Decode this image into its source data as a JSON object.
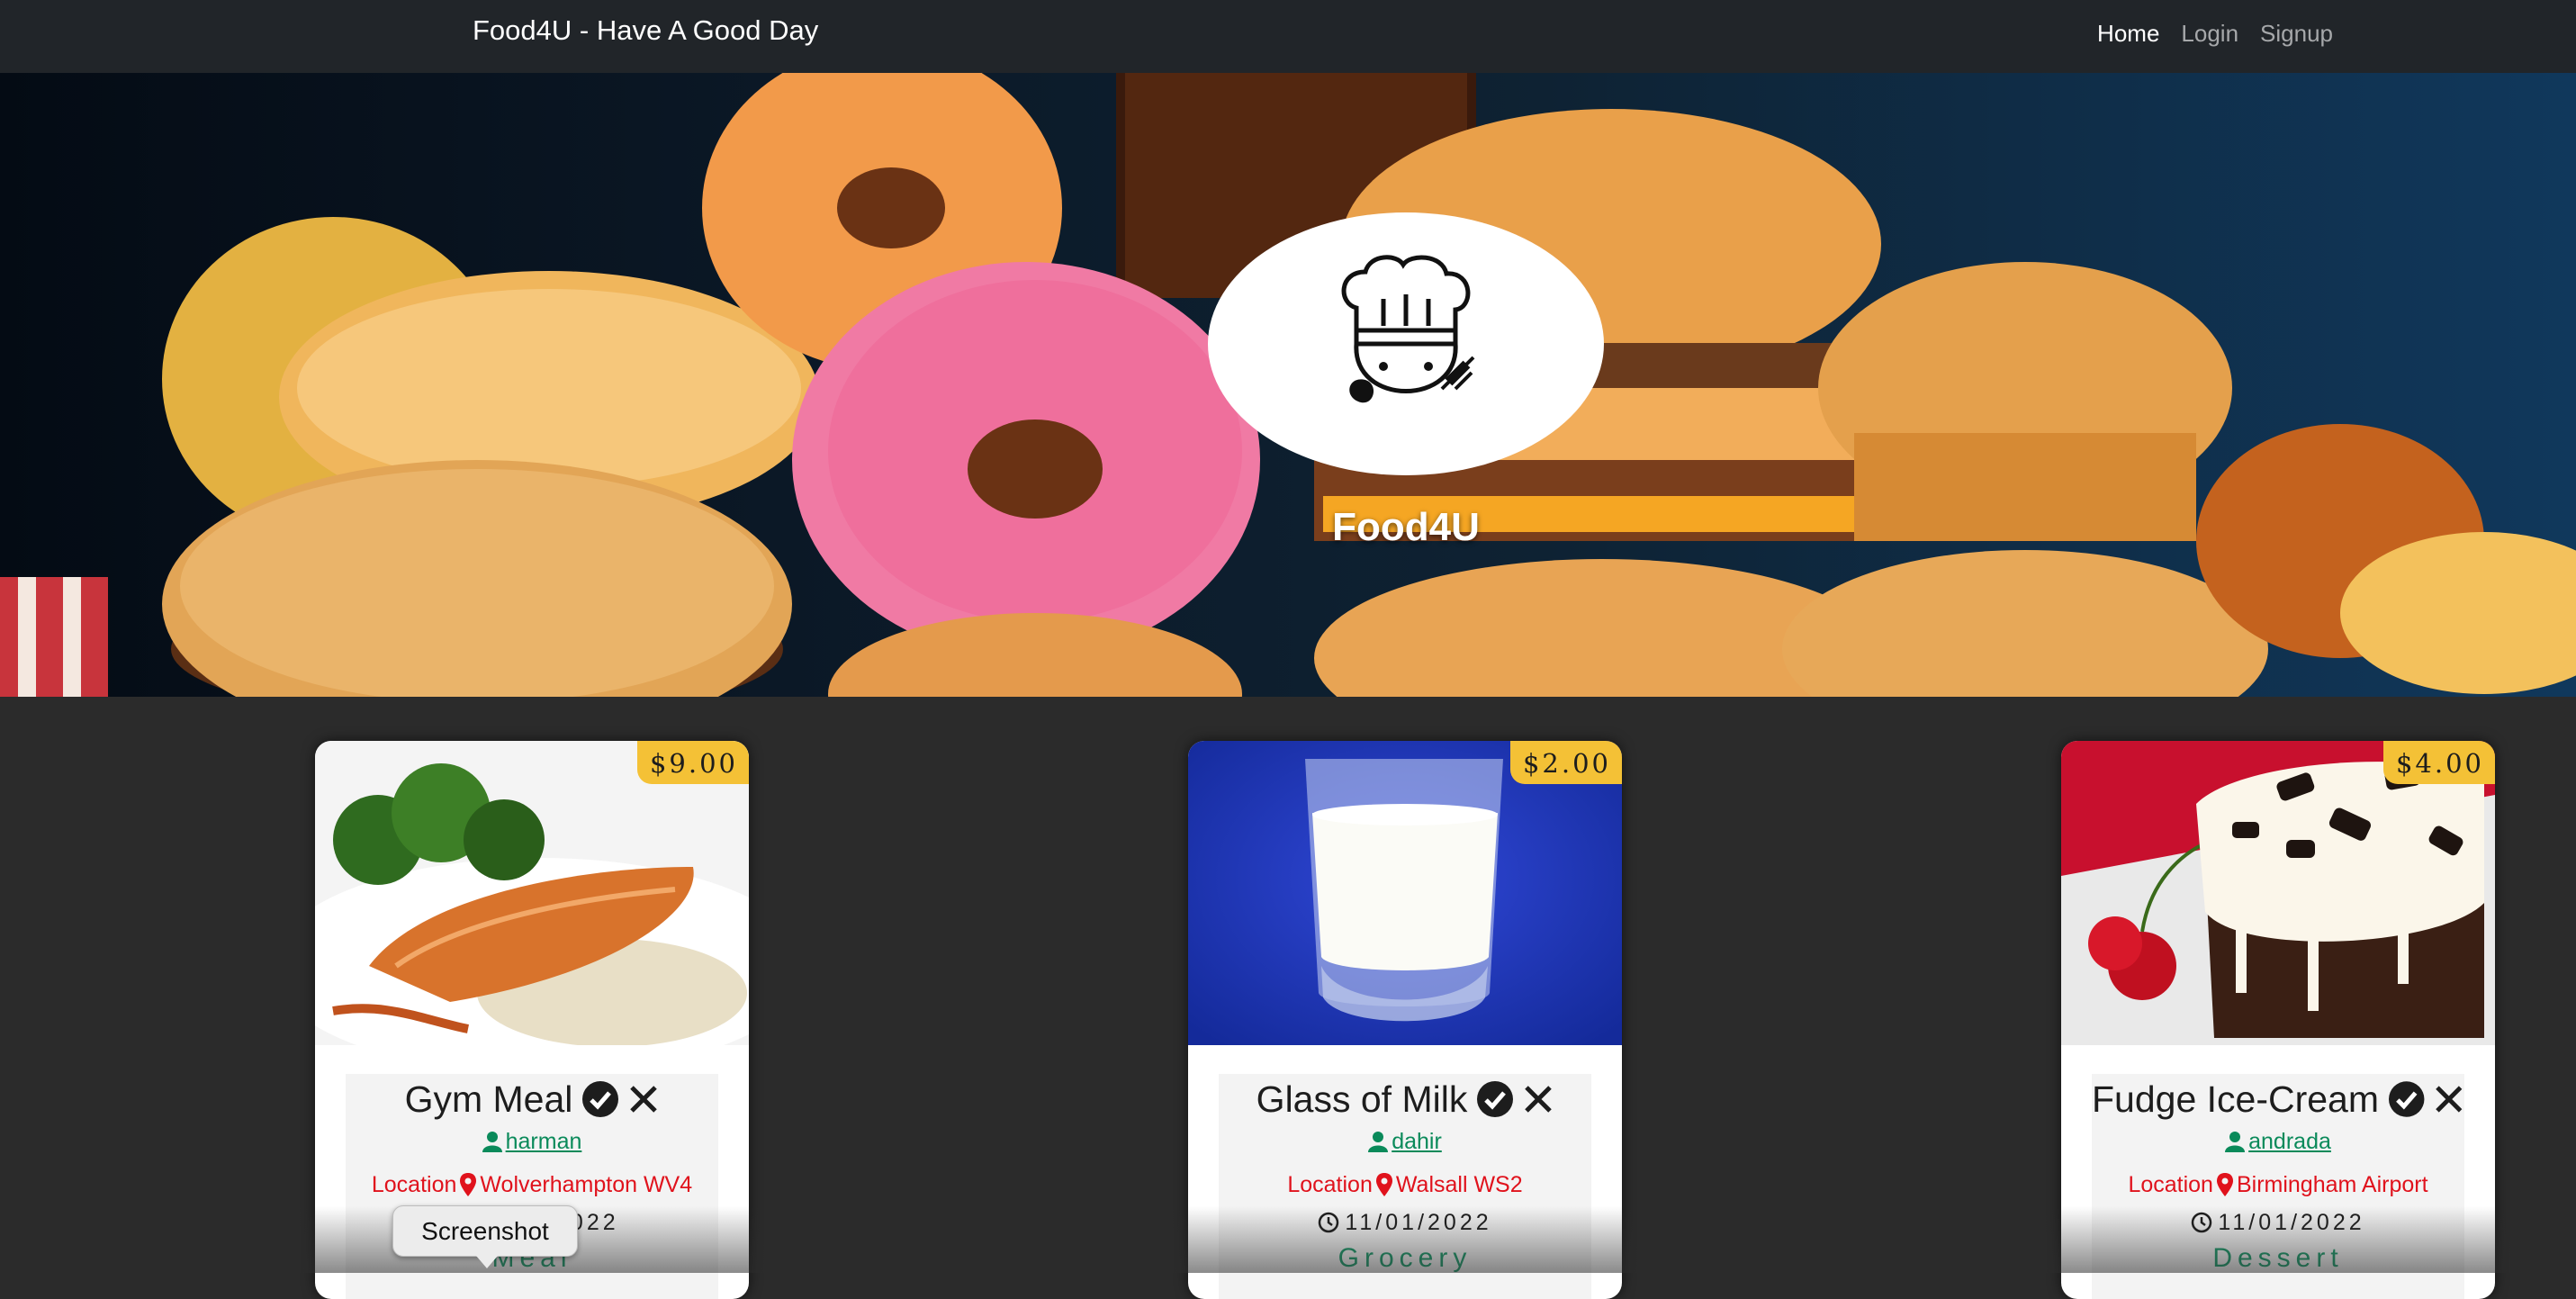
{
  "navbar": {
    "brand": "Food4U - Have A Good Day",
    "links": [
      {
        "label": "Home",
        "active": true
      },
      {
        "label": "Login",
        "active": false
      },
      {
        "label": "Signup",
        "active": false
      }
    ]
  },
  "hero": {
    "title": "Food4U",
    "logo_icon": "chef-logo-icon"
  },
  "cards": [
    {
      "price": "$9.00",
      "title": "Gym Meal",
      "user": "harman",
      "location_label": "Location",
      "location": "Wolverhampton WV4",
      "date": "11/01/2022",
      "category": "Meal",
      "image": "salmon-rice-broccoli-image"
    },
    {
      "price": "$2.00",
      "title": "Glass of Milk",
      "user": "dahir",
      "location_label": "Location",
      "location": "Walsall WS2",
      "date": "11/01/2022",
      "category": "Grocery",
      "image": "glass-of-milk-image"
    },
    {
      "price": "$4.00",
      "title": "Fudge Ice-Cream",
      "user": "andrada",
      "location_label": "Location",
      "location": "Birmingham Airport",
      "date": "11/01/2022",
      "category": "Dessert",
      "image": "fudge-ice-cream-image"
    }
  ],
  "tooltip": {
    "text": "Screenshot"
  },
  "colors": {
    "navbar": "#212529",
    "page_bg": "#2b2b2b",
    "price_badge": "#f4c136",
    "user_link": "#0a8a5a",
    "location": "#e0121c",
    "category": "#1a9a6a"
  }
}
